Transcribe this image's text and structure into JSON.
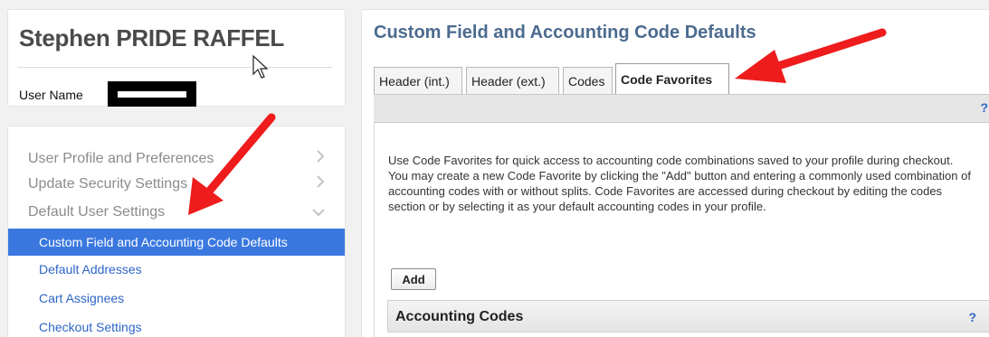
{
  "profile": {
    "full_name": "Stephen PRIDE RAFFEL",
    "username_label": "User Name"
  },
  "nav": {
    "items": [
      {
        "label": "User Profile and Preferences"
      },
      {
        "label": "Update Security Settings"
      },
      {
        "label": "Default User Settings"
      }
    ],
    "sub_items": [
      {
        "label": "Custom Field and Accounting Code Defaults"
      },
      {
        "label": "Default Addresses"
      },
      {
        "label": "Cart Assignees"
      },
      {
        "label": "Checkout Settings"
      }
    ]
  },
  "main": {
    "title": "Custom Field and Accounting Code Defaults",
    "tabs": [
      {
        "label": "Header (int.)"
      },
      {
        "label": "Header (ext.)"
      },
      {
        "label": "Codes"
      },
      {
        "label": "Code Favorites"
      }
    ],
    "help": "?",
    "description": "Use Code Favorites for quick access to accounting code combinations saved to your profile during checkout. You may create a new Code Favorite by clicking the \"Add\" button and entering a commonly used combination of accounting codes with or without splits. Code Favorites are accessed during checkout by editing the codes section or by selecting it as your default accounting codes in your profile.",
    "add_label": "Add",
    "section_title": "Accounting Codes"
  },
  "colors": {
    "accent": "#3a78e0",
    "link": "#2e66c6",
    "title": "#4c6b8f",
    "arrow": "#ee1c1c"
  }
}
